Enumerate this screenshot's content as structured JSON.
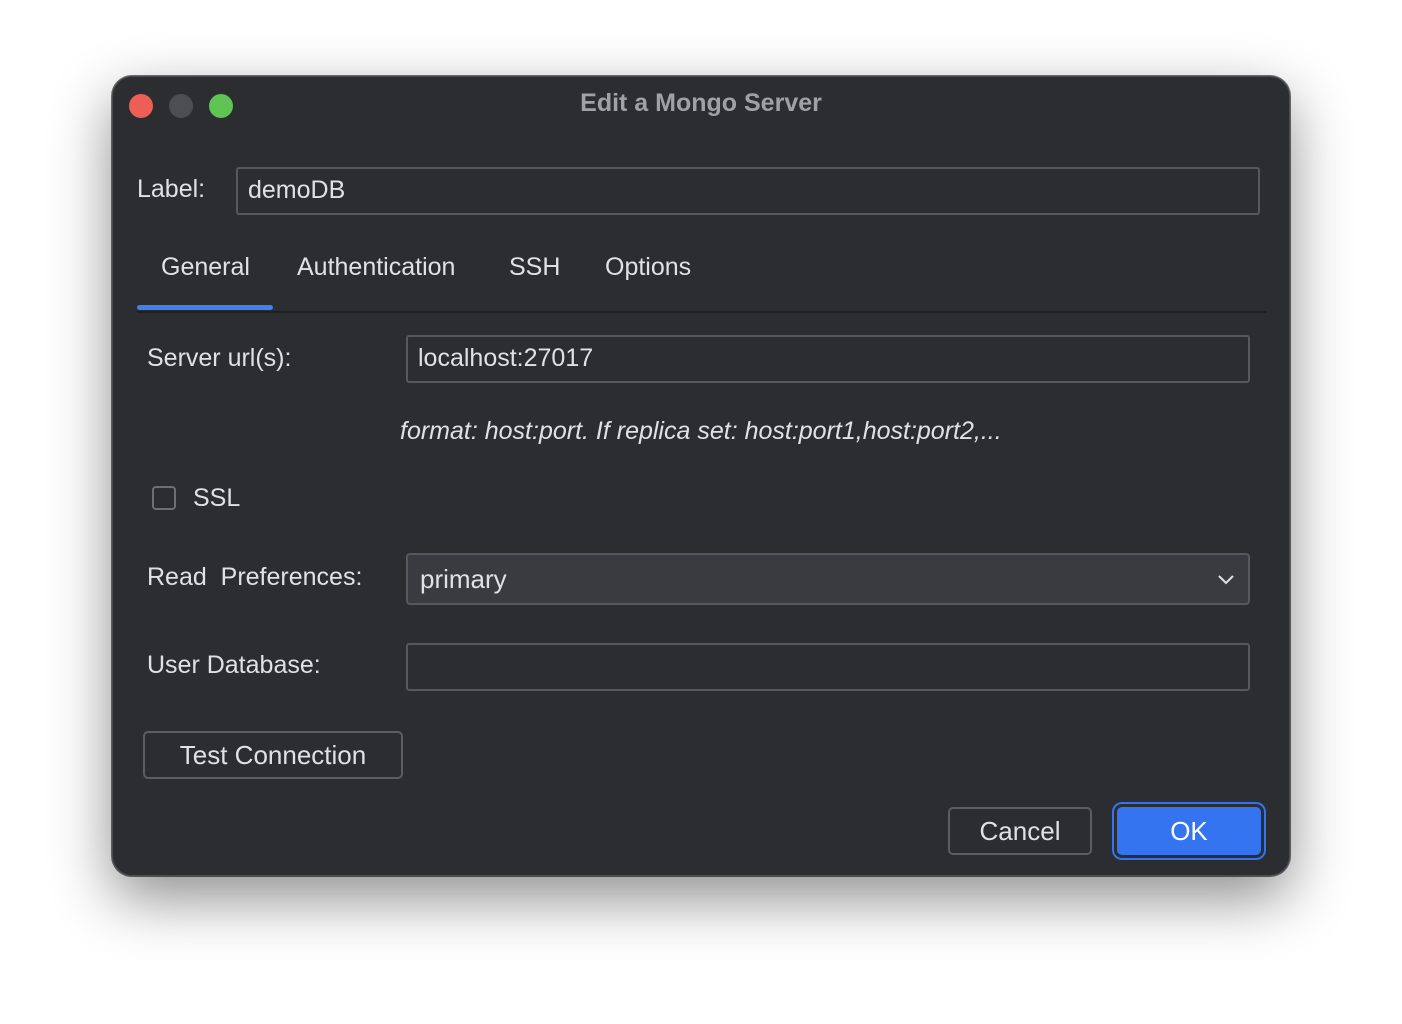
{
  "window": {
    "title": "Edit a Mongo Server"
  },
  "label_field": {
    "label": "Label:",
    "value": "demoDB"
  },
  "tabs": [
    {
      "label": "General",
      "selected": true
    },
    {
      "label": "Authentication",
      "selected": false
    },
    {
      "label": "SSH",
      "selected": false
    },
    {
      "label": "Options",
      "selected": false
    }
  ],
  "general": {
    "server_urls_label": "Server url(s):",
    "server_urls_value": "localhost:27017",
    "format_hint": "format: host:port. If replica set: host:port1,host:port2,...",
    "ssl_label": "SSL",
    "ssl_checked": false,
    "read_preferences_label": "Read  Preferences:",
    "read_preferences_value": "primary",
    "user_database_label": "User Database:",
    "user_database_value": ""
  },
  "buttons": {
    "test_connection": "Test Connection",
    "cancel": "Cancel",
    "ok": "OK"
  },
  "colors": {
    "window_bg": "#2b2d30",
    "accent": "#3574f0",
    "tab_underline": "#3b82f6",
    "close": "#ec5f57",
    "minimize": "#4d4e52",
    "zoom": "#5fc454"
  }
}
